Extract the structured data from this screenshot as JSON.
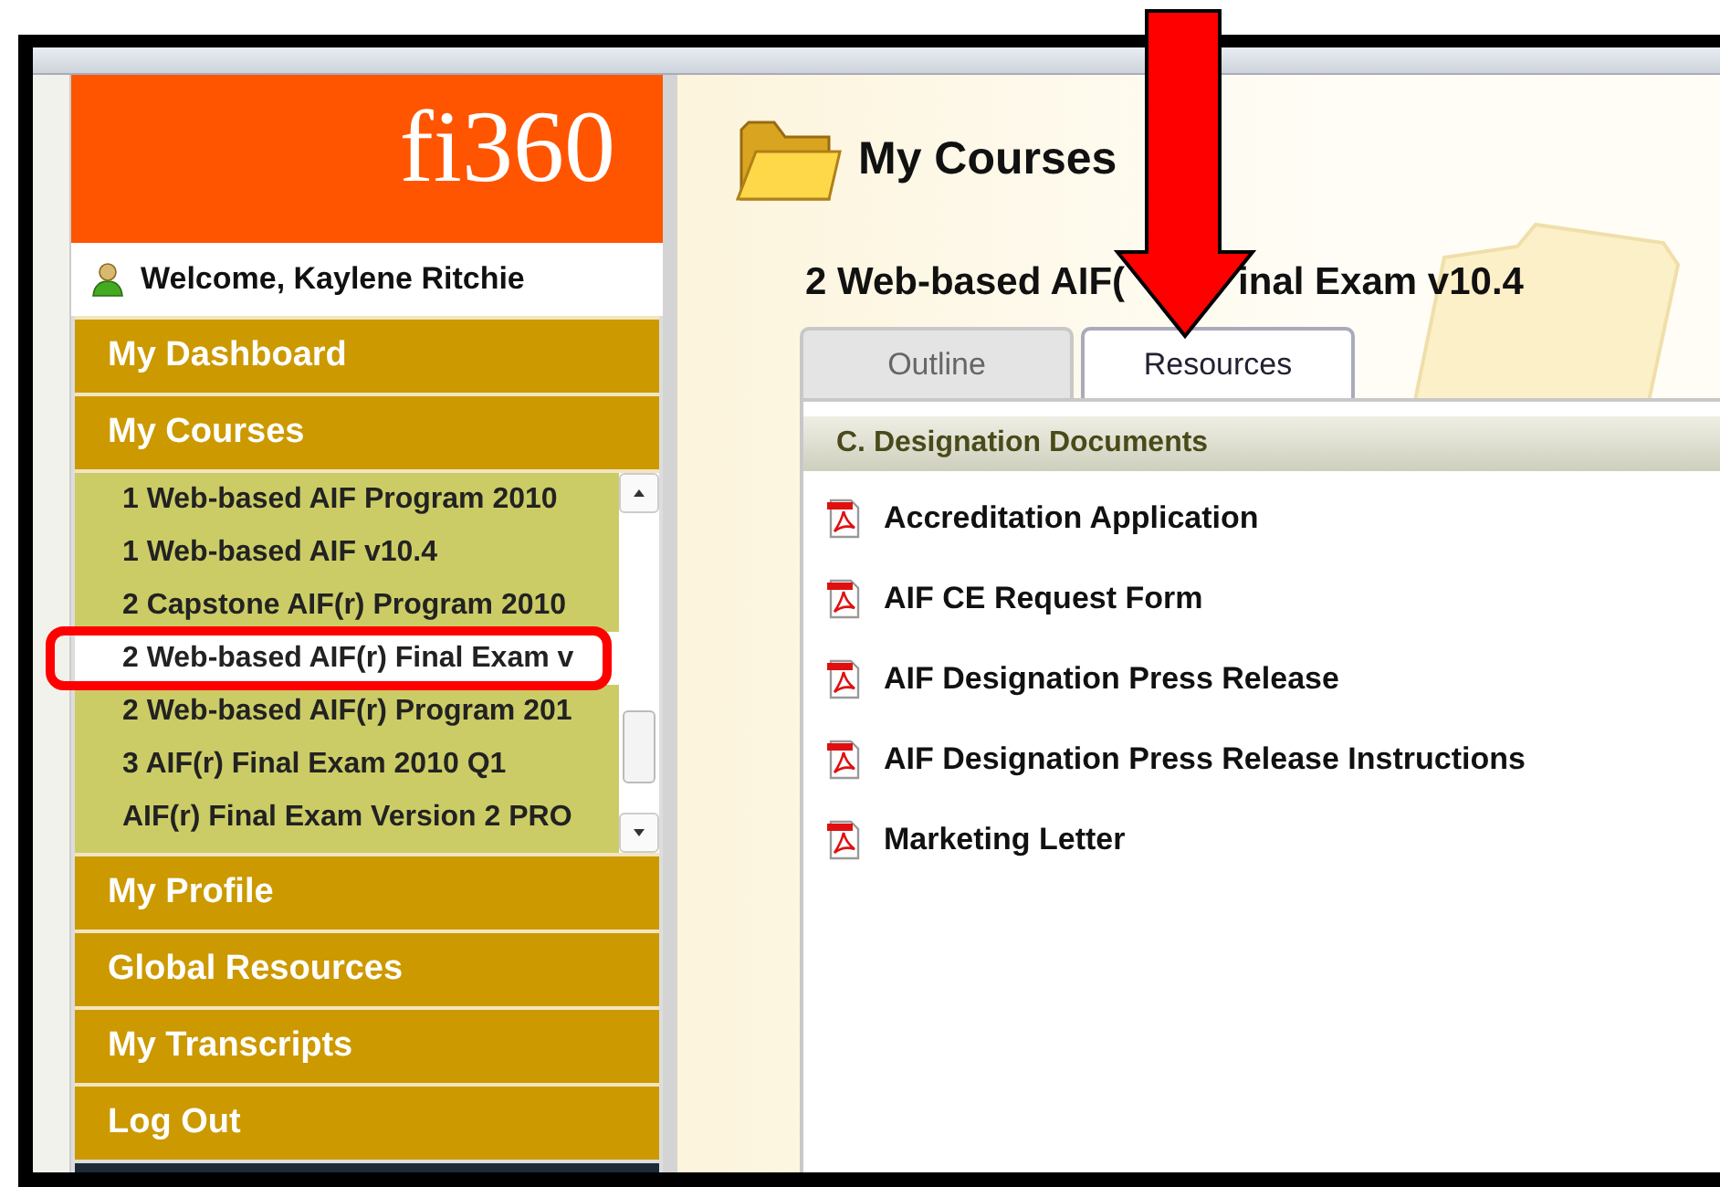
{
  "logo": {
    "text": "fi360"
  },
  "welcome": "Welcome, Kaylene Ritchie",
  "nav_top": [
    {
      "label": "My Dashboard"
    },
    {
      "label": "My Courses"
    }
  ],
  "course_list": [
    {
      "label": "1 Web-based AIF Program 2010",
      "selected": false
    },
    {
      "label": "1 Web-based AIF v10.4",
      "selected": false
    },
    {
      "label": "2 Capstone AIF(r) Program 2010",
      "selected": false
    },
    {
      "label": "2 Web-based AIF(r) Final Exam v",
      "selected": true
    },
    {
      "label": "2 Web-based AIF(r) Program 201",
      "selected": false
    },
    {
      "label": "3 AIF(r) Final Exam 2010 Q1",
      "selected": false
    },
    {
      "label": "AIF(r) Final Exam Version 2 PRO",
      "selected": false
    }
  ],
  "nav_bottom": [
    {
      "label": "My Profile"
    },
    {
      "label": "Global Resources"
    },
    {
      "label": "My Transcripts"
    },
    {
      "label": "Log Out"
    }
  ],
  "main": {
    "heading": "My Courses",
    "course_title_parts": [
      "2 Web-based AIF(",
      "inal Exam v10.4"
    ],
    "tabs": [
      {
        "label": "Outline",
        "selected": false
      },
      {
        "label": "Resources",
        "selected": true
      }
    ],
    "section": "C. Designation Documents",
    "documents": [
      {
        "label": "Accreditation Application"
      },
      {
        "label": "AIF CE Request Form"
      },
      {
        "label": "AIF Designation Press Release"
      },
      {
        "label": "AIF Designation Press Release Instructions"
      },
      {
        "label": "Marketing Letter"
      }
    ]
  }
}
